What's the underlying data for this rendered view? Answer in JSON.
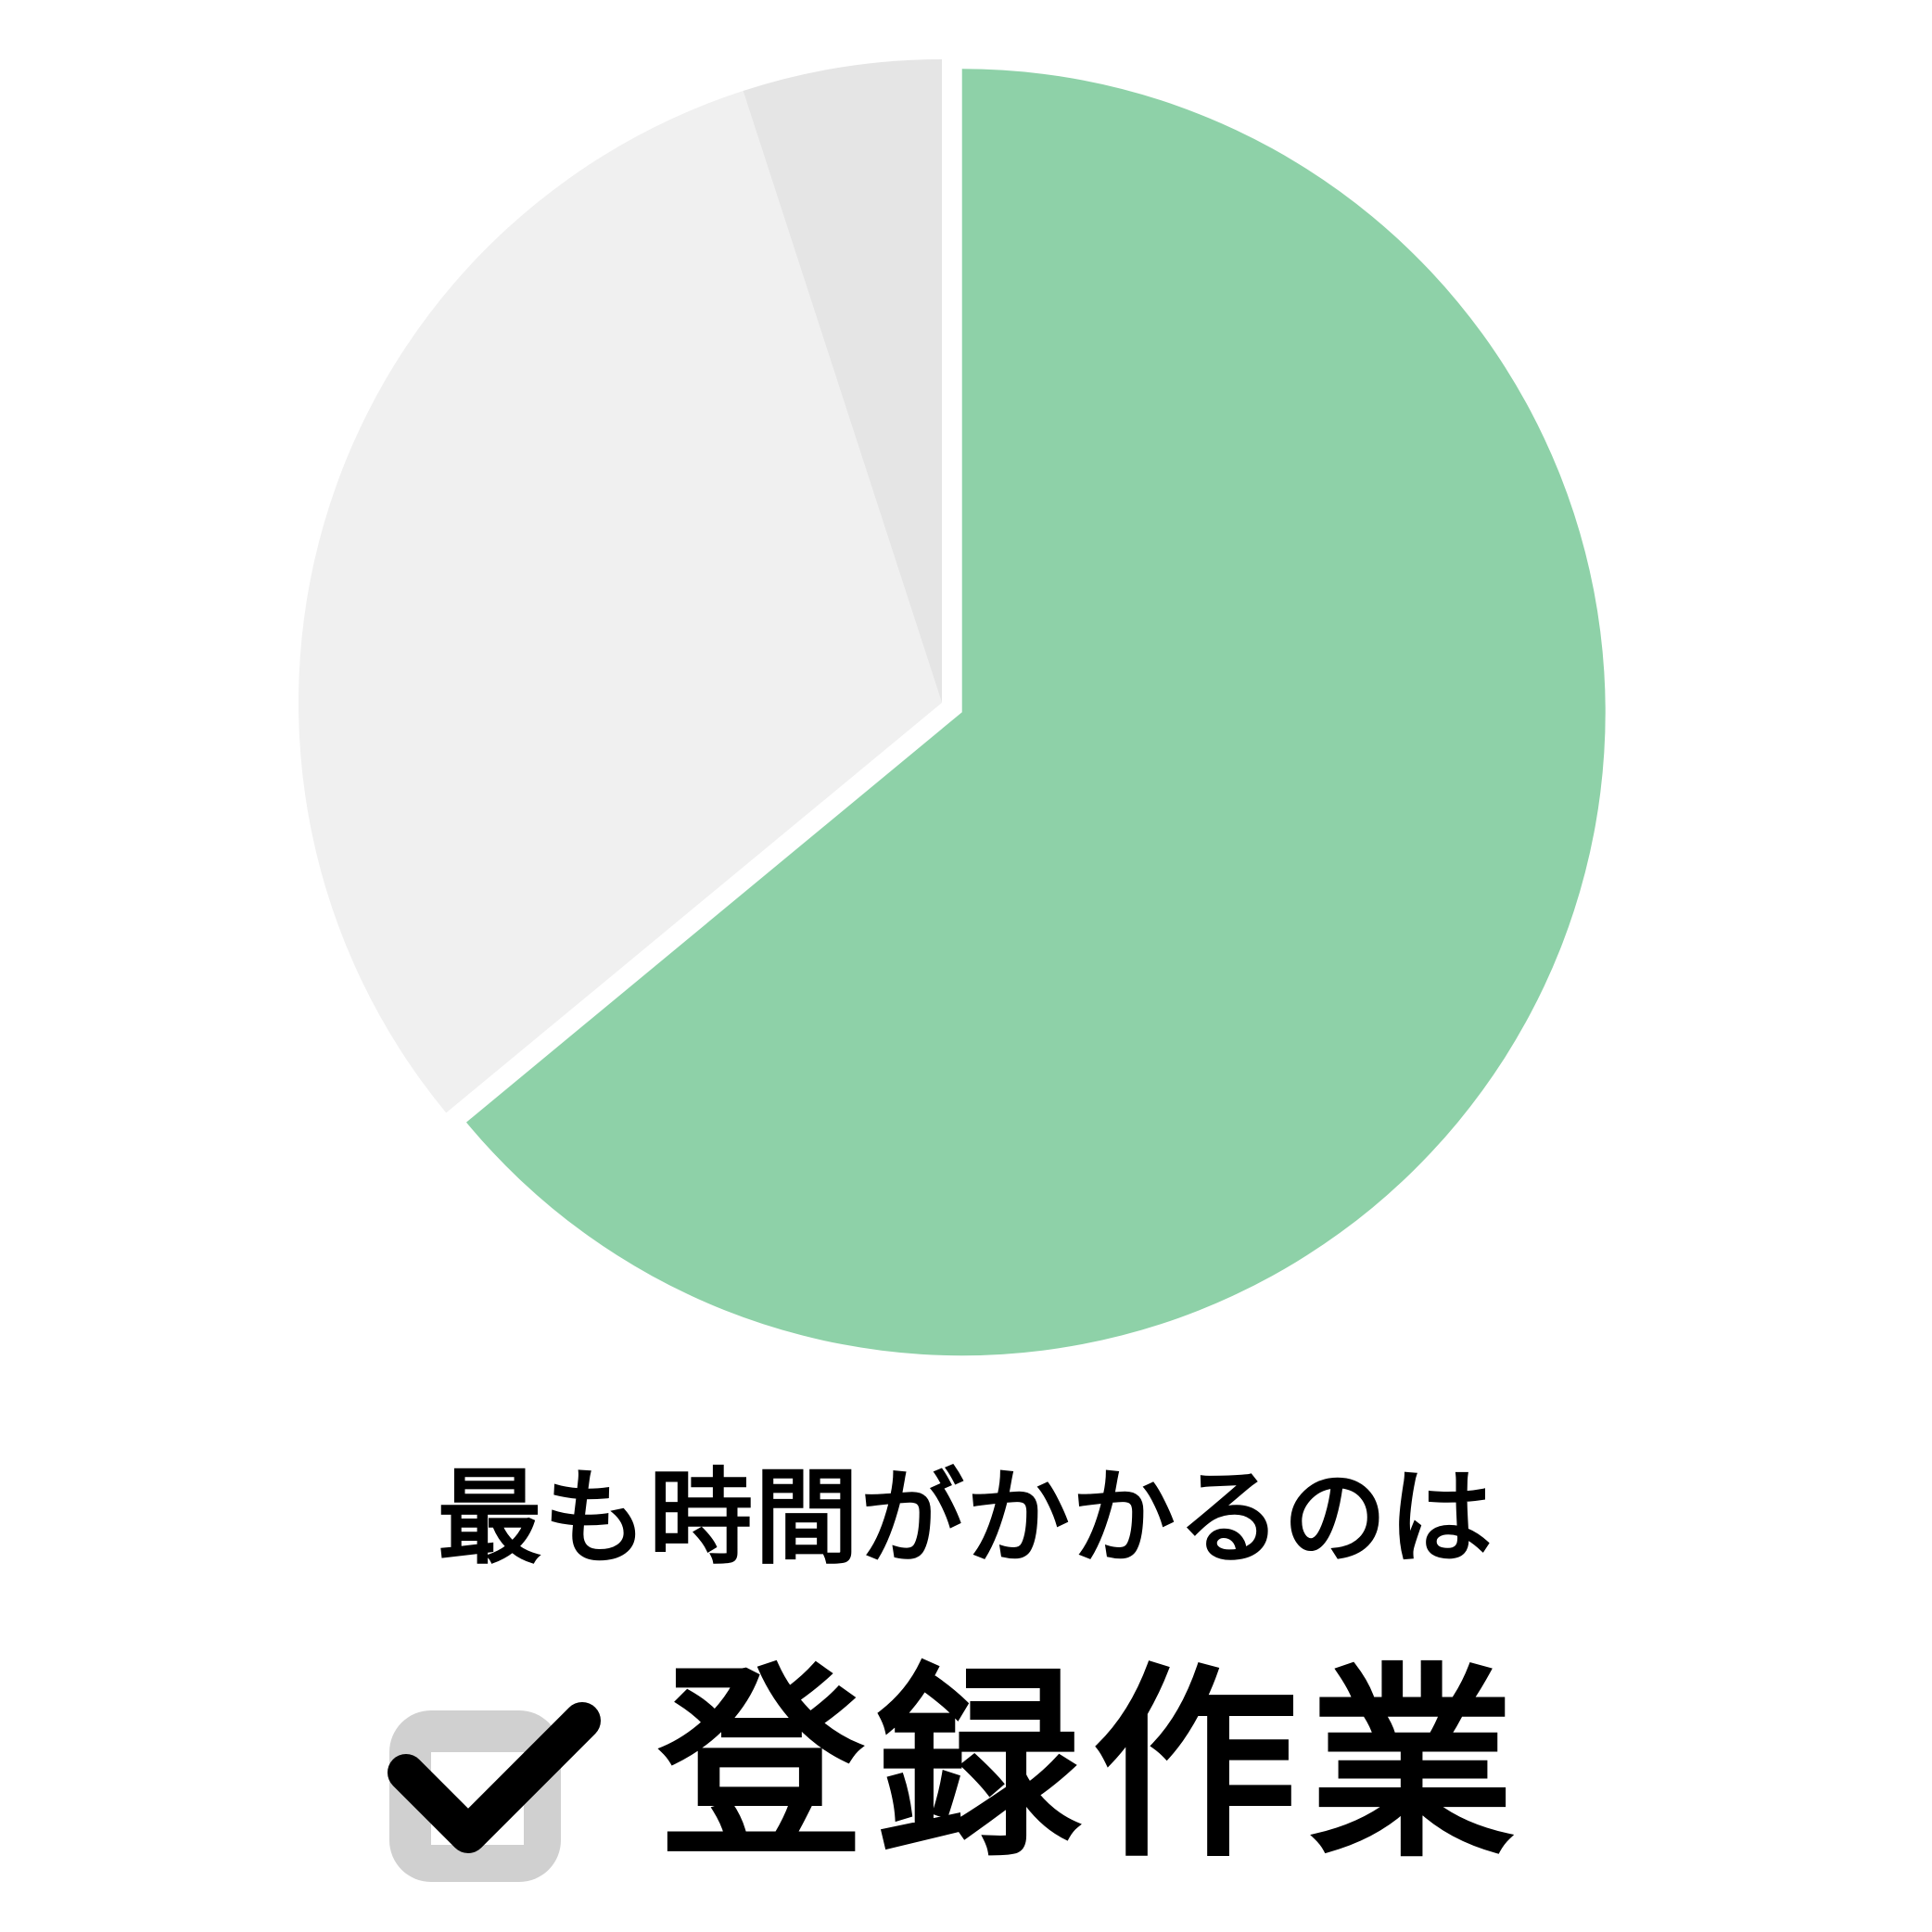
{
  "chart_data": {
    "type": "pie",
    "title": "最も時間がかかるのは",
    "highlight": "登録作業",
    "slices": [
      {
        "value": 64,
        "color": "#8ED1A8",
        "exploded": true
      },
      {
        "value": 31,
        "color": "#F0F0F0",
        "exploded": false
      },
      {
        "value": 5,
        "color": "#E5E5E5",
        "exploded": false
      }
    ]
  },
  "icons": {
    "check": "checkbox-check-icon"
  },
  "colors": {
    "background": "#FFFFFF",
    "text": "#000000",
    "checkbox_frame": "#D0D0D0",
    "checkmark": "#000000"
  }
}
